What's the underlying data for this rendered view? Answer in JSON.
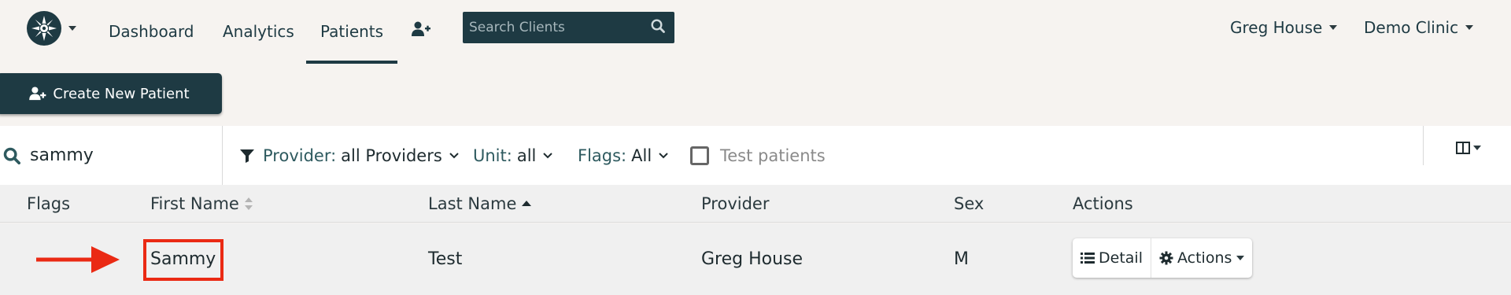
{
  "nav": {
    "links": [
      {
        "label": "Dashboard",
        "active": false
      },
      {
        "label": "Analytics",
        "active": false
      },
      {
        "label": "Patients",
        "active": true
      }
    ],
    "search_placeholder": "Search Clients",
    "user": "Greg House",
    "clinic": "Demo Clinic",
    "logo_icon": "star-burst-icon",
    "add_patient_icon": "user-plus-icon"
  },
  "toolbar": {
    "create_label": "Create New Patient"
  },
  "filters": {
    "search_value": "sammy",
    "provider_label": "Provider:",
    "provider_value": "all Providers",
    "unit_label": "Unit:",
    "unit_value": "all",
    "flags_label": "Flags:",
    "flags_value": "All",
    "test_patients_label": "Test patients",
    "test_patients_checked": false
  },
  "table": {
    "columns": [
      "Flags",
      "First Name",
      "Last Name",
      "Provider",
      "Sex",
      "Actions"
    ],
    "rows": [
      {
        "flags": "",
        "first_name": "Sammy",
        "last_name": "Test",
        "provider": "Greg House",
        "sex": "M"
      }
    ],
    "row_buttons": {
      "detail": "Detail",
      "actions": "Actions"
    }
  },
  "colors": {
    "primary": "#1e3a43",
    "background": "#f6f3f0",
    "highlight": "#ea2a14"
  }
}
